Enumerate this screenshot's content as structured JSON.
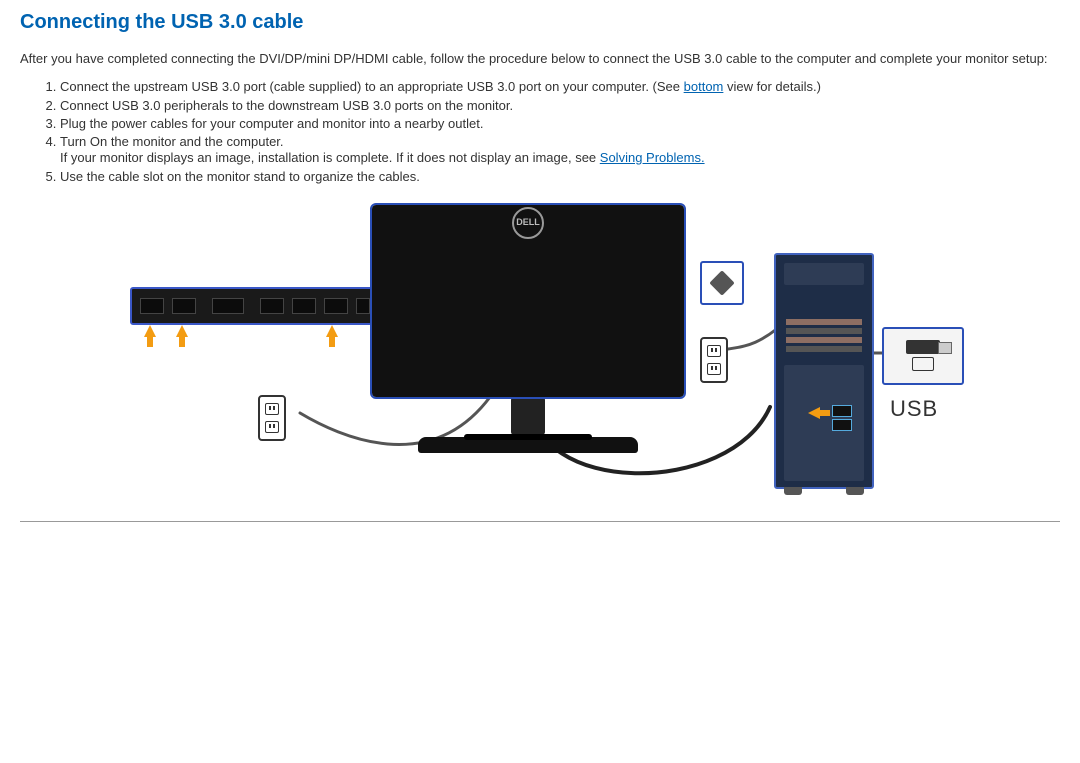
{
  "heading": "Connecting the USB 3.0 cable",
  "intro": "After you have completed connecting the DVI/DP/mini DP/HDMI cable, follow the procedure below to connect the USB 3.0 cable to the computer and complete your monitor setup:",
  "steps": {
    "s1a": "Connect the upstream USB 3.0 port (cable supplied) to an appropriate USB 3.0 port on your computer. (See ",
    "s1link": "bottom",
    "s1b": " view for details.)",
    "s2": "Connect USB 3.0 peripherals to the downstream USB 3.0 ports on the monitor.",
    "s3": "Plug the power cables for your computer and monitor into a nearby outlet.",
    "s4a": "Turn On the monitor and the computer.",
    "s4b": "If your monitor displays an image, installation is complete. If it does not display an image, see ",
    "s4link": "Solving Problems.",
    "s5": "Use the cable slot on the monitor stand to organize the cables."
  },
  "figure": {
    "usb_label": "USB",
    "logo": "DELL"
  }
}
